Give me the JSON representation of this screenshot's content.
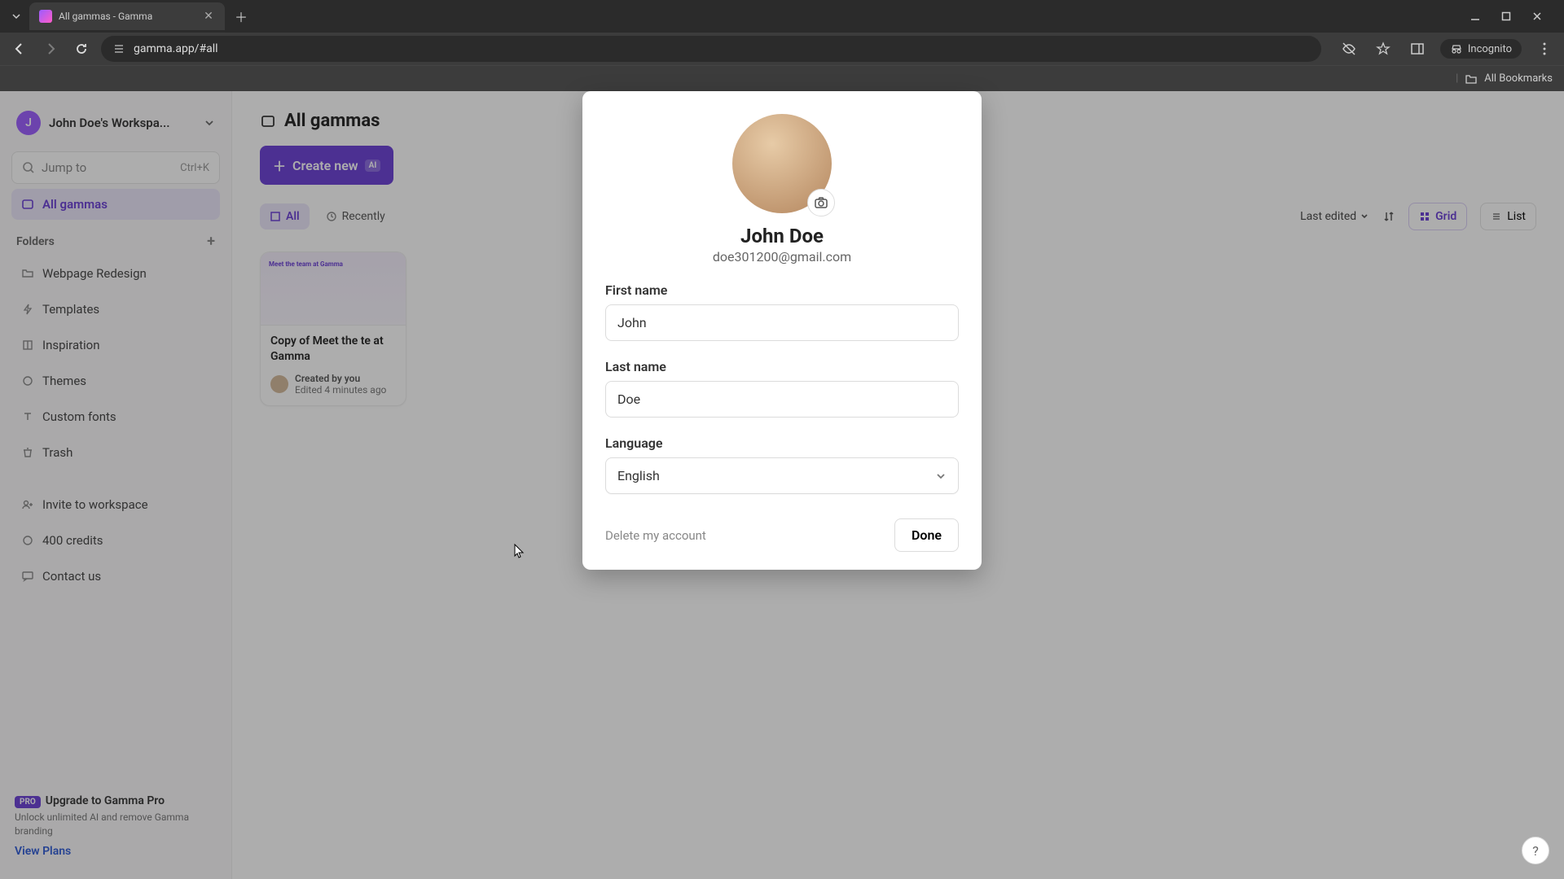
{
  "browser": {
    "tab_title": "All gammas - Gamma",
    "url": "gamma.app/#all",
    "incognito_label": "Incognito",
    "all_bookmarks": "All Bookmarks"
  },
  "sidebar": {
    "workspace_initial": "J",
    "workspace_name": "John Doe's Workspa...",
    "jump_placeholder": "Jump to",
    "jump_kbd": "Ctrl+K",
    "all_gammas": "All gammas",
    "folders_label": "Folders",
    "folder1": "Webpage Redesign",
    "templates": "Templates",
    "inspiration": "Inspiration",
    "themes": "Themes",
    "custom_fonts": "Custom fonts",
    "trash": "Trash",
    "invite": "Invite to workspace",
    "credits": "400 credits",
    "contact": "Contact us",
    "pro_badge": "PRO",
    "pro_title": "Upgrade to Gamma Pro",
    "pro_sub": "Unlock unlimited AI and remove Gamma branding",
    "pro_link": "View Plans"
  },
  "main": {
    "heading": "All gammas",
    "create_label": "Create new",
    "ai_badge": "AI",
    "filter_all": "All",
    "filter_recent": "Recently",
    "sort_label": "Last edited",
    "view_grid": "Grid",
    "view_list": "List",
    "card_thumb_caption": "Meet the team at Gamma",
    "card_title": "Copy of Meet the te at Gamma",
    "card_created": "Created by you",
    "card_edited": "Edited 4 minutes ago"
  },
  "modal": {
    "user_name": "John Doe",
    "user_email": "doe301200@gmail.com",
    "first_name_label": "First name",
    "first_name_value": "John",
    "last_name_label": "Last name",
    "last_name_value": "Doe",
    "language_label": "Language",
    "language_value": "English",
    "delete_label": "Delete my account",
    "done_label": "Done"
  }
}
